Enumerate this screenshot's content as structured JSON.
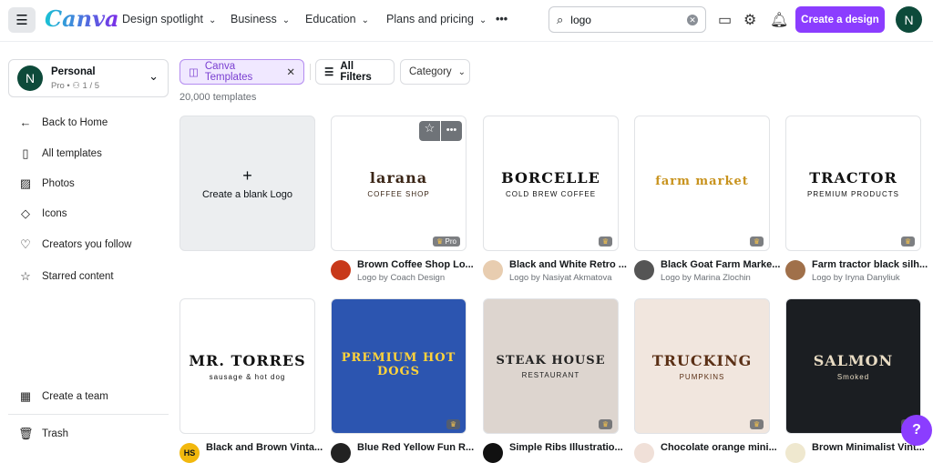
{
  "header": {
    "brand": "Canva",
    "nav": [
      "Design spotlight",
      "Business",
      "Education",
      "Plans and pricing"
    ],
    "more": "•••",
    "search_value": "logo",
    "create_label": "Create a design",
    "avatar": "N"
  },
  "sidebar": {
    "team_name": "Personal",
    "team_sub": "Pro • ⚇ 1 / 5",
    "avatar": "N",
    "items": [
      {
        "label": "Back to Home",
        "icon": "←"
      },
      {
        "label": "All templates",
        "icon": "▯"
      },
      {
        "label": "Photos",
        "icon": "▨"
      },
      {
        "label": "Icons",
        "icon": "◇"
      },
      {
        "label": "Creators you follow",
        "icon": "♡"
      },
      {
        "label": "Starred content",
        "icon": "☆"
      }
    ],
    "bottom": [
      {
        "label": "Create a team",
        "icon": "▦"
      },
      {
        "label": "Trash",
        "icon": "🗑"
      }
    ]
  },
  "filters": {
    "active": "Canva Templates",
    "all_filters": "All Filters",
    "category": "Category",
    "count": "20,000 templates"
  },
  "blank": {
    "plus": "+",
    "label": "Create a blank Logo"
  },
  "templates": [
    {
      "title": "Brown Coffee Shop Lo...",
      "author": "Logo by Coach Design",
      "art": "larana",
      "art_sub": "COFFEE SHOP",
      "bg": "#ffffff",
      "fg": "#3a2516",
      "badge": "Pro",
      "avatar": "#c8391a"
    },
    {
      "title": "Black and White Retro ...",
      "author": "Logo by Nasiyat Akmatova",
      "art": "BORCELLE",
      "art_sub": "COLD BREW COFFEE",
      "bg": "#ffffff",
      "fg": "#111111",
      "badge": "♛",
      "avatar": "#e8cdb0"
    },
    {
      "title": "Black Goat Farm Marke...",
      "author": "Logo by Marina Zlochin",
      "art": "farm market",
      "art_sub": "",
      "bg": "#ffffff",
      "fg": "#c8931e",
      "badge": "♛",
      "avatar": "#555555"
    },
    {
      "title": "Farm tractor black silh...",
      "author": "Logo by Iryna Danyliuk",
      "art": "TRACTOR",
      "art_sub": "PREMIUM PRODUCTS",
      "bg": "#ffffff",
      "fg": "#111111",
      "badge": "♛",
      "avatar": "#a0704a"
    },
    {
      "title": "Black and Brown Vinta...",
      "author": "",
      "art": "MR. TORRES",
      "art_sub": "sausage & hot dog",
      "bg": "#ffffff",
      "fg": "#111111",
      "badge": "",
      "avatar": "#f2b80e",
      "avatar_text": "HS"
    },
    {
      "title": "Blue Red Yellow Fun R...",
      "author": "",
      "art": "PREMIUM HOT DOGS",
      "art_sub": "",
      "bg": "#2c55b0",
      "fg": "#ffd33a",
      "badge": "♛",
      "avatar": "#222222"
    },
    {
      "title": "Simple Ribs Illustratio...",
      "author": "",
      "art": "STEAK HOUSE",
      "art_sub": "RESTAURANT",
      "bg": "#ddd5cf",
      "fg": "#222222",
      "badge": "♛",
      "avatar": "#111111"
    },
    {
      "title": "Chocolate orange mini...",
      "author": "",
      "art": "TRUCKING",
      "art_sub": "PUMPKINS",
      "bg": "#f1e6de",
      "fg": "#5a2f15",
      "badge": "♛",
      "avatar": "#f0e0d8"
    },
    {
      "title": "Brown Minimalist Vint...",
      "author": "",
      "art": "SALMON",
      "art_sub": "Smoked",
      "bg": "#1b1e22",
      "fg": "#e9dcc4",
      "badge": "♛",
      "avatar": "#efe8cf"
    }
  ],
  "help": "?"
}
